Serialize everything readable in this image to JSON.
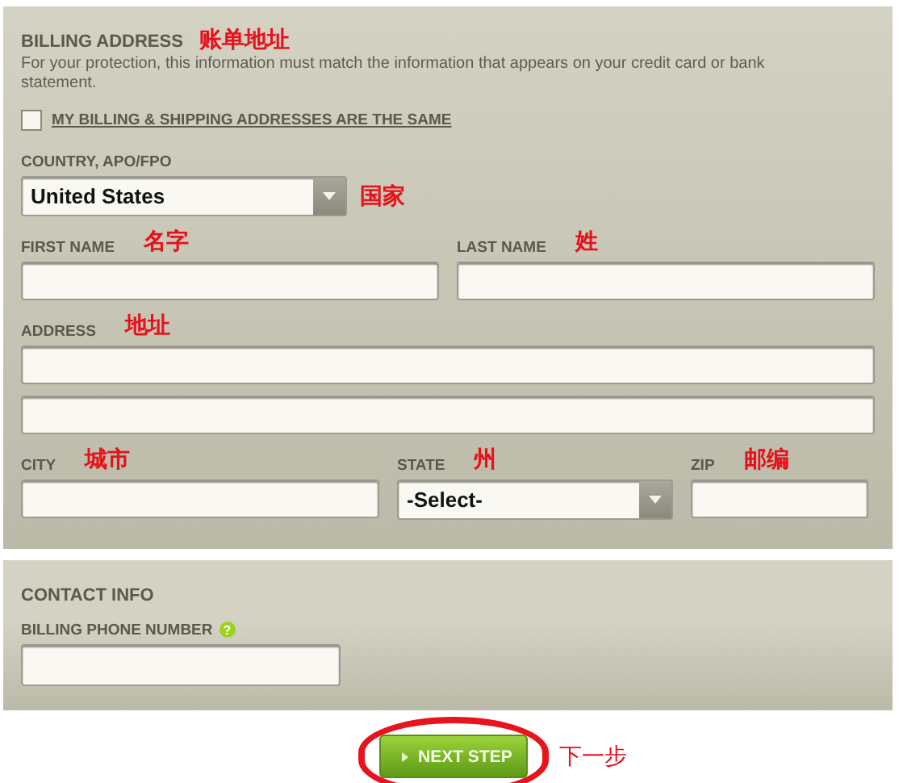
{
  "billing_address": {
    "title": "BILLING ADDRESS",
    "annotation": "账单地址",
    "note": "For your protection, this information must match the information that appears on your credit card or bank statement.",
    "same_address_checkbox": {
      "label": "MY BILLING & SHIPPING ADDRESSES ARE THE SAME",
      "checked": false
    },
    "rows": [
      {
        "fields": [
          {
            "kind": "select",
            "label": "COUNTRY, APO/FPO",
            "side_annotation": "国家",
            "value": "United States"
          }
        ]
      },
      {
        "fields": [
          {
            "kind": "text",
            "label": "FIRST NAME",
            "annotation": "名字"
          },
          {
            "kind": "text",
            "label": "LAST NAME",
            "annotation": "姓"
          }
        ]
      },
      {
        "fields": [
          {
            "kind": "text",
            "label": "ADDRESS",
            "annotation": "地址"
          }
        ]
      },
      {
        "fields": [
          {
            "kind": "text"
          }
        ]
      },
      {
        "fields": [
          {
            "kind": "text",
            "label": "CITY",
            "annotation": "城市"
          },
          {
            "kind": "select",
            "label": "STATE",
            "annotation": "州",
            "value": "-Select-"
          },
          {
            "kind": "text",
            "label": "ZIP",
            "annotation": "邮编"
          }
        ]
      }
    ]
  },
  "contact_info": {
    "title": "CONTACT INFO",
    "phone_label": "BILLING PHONE NUMBER",
    "help_icon": "?"
  },
  "next_button": {
    "label": "NEXT STEP",
    "annotation": "下一步"
  }
}
